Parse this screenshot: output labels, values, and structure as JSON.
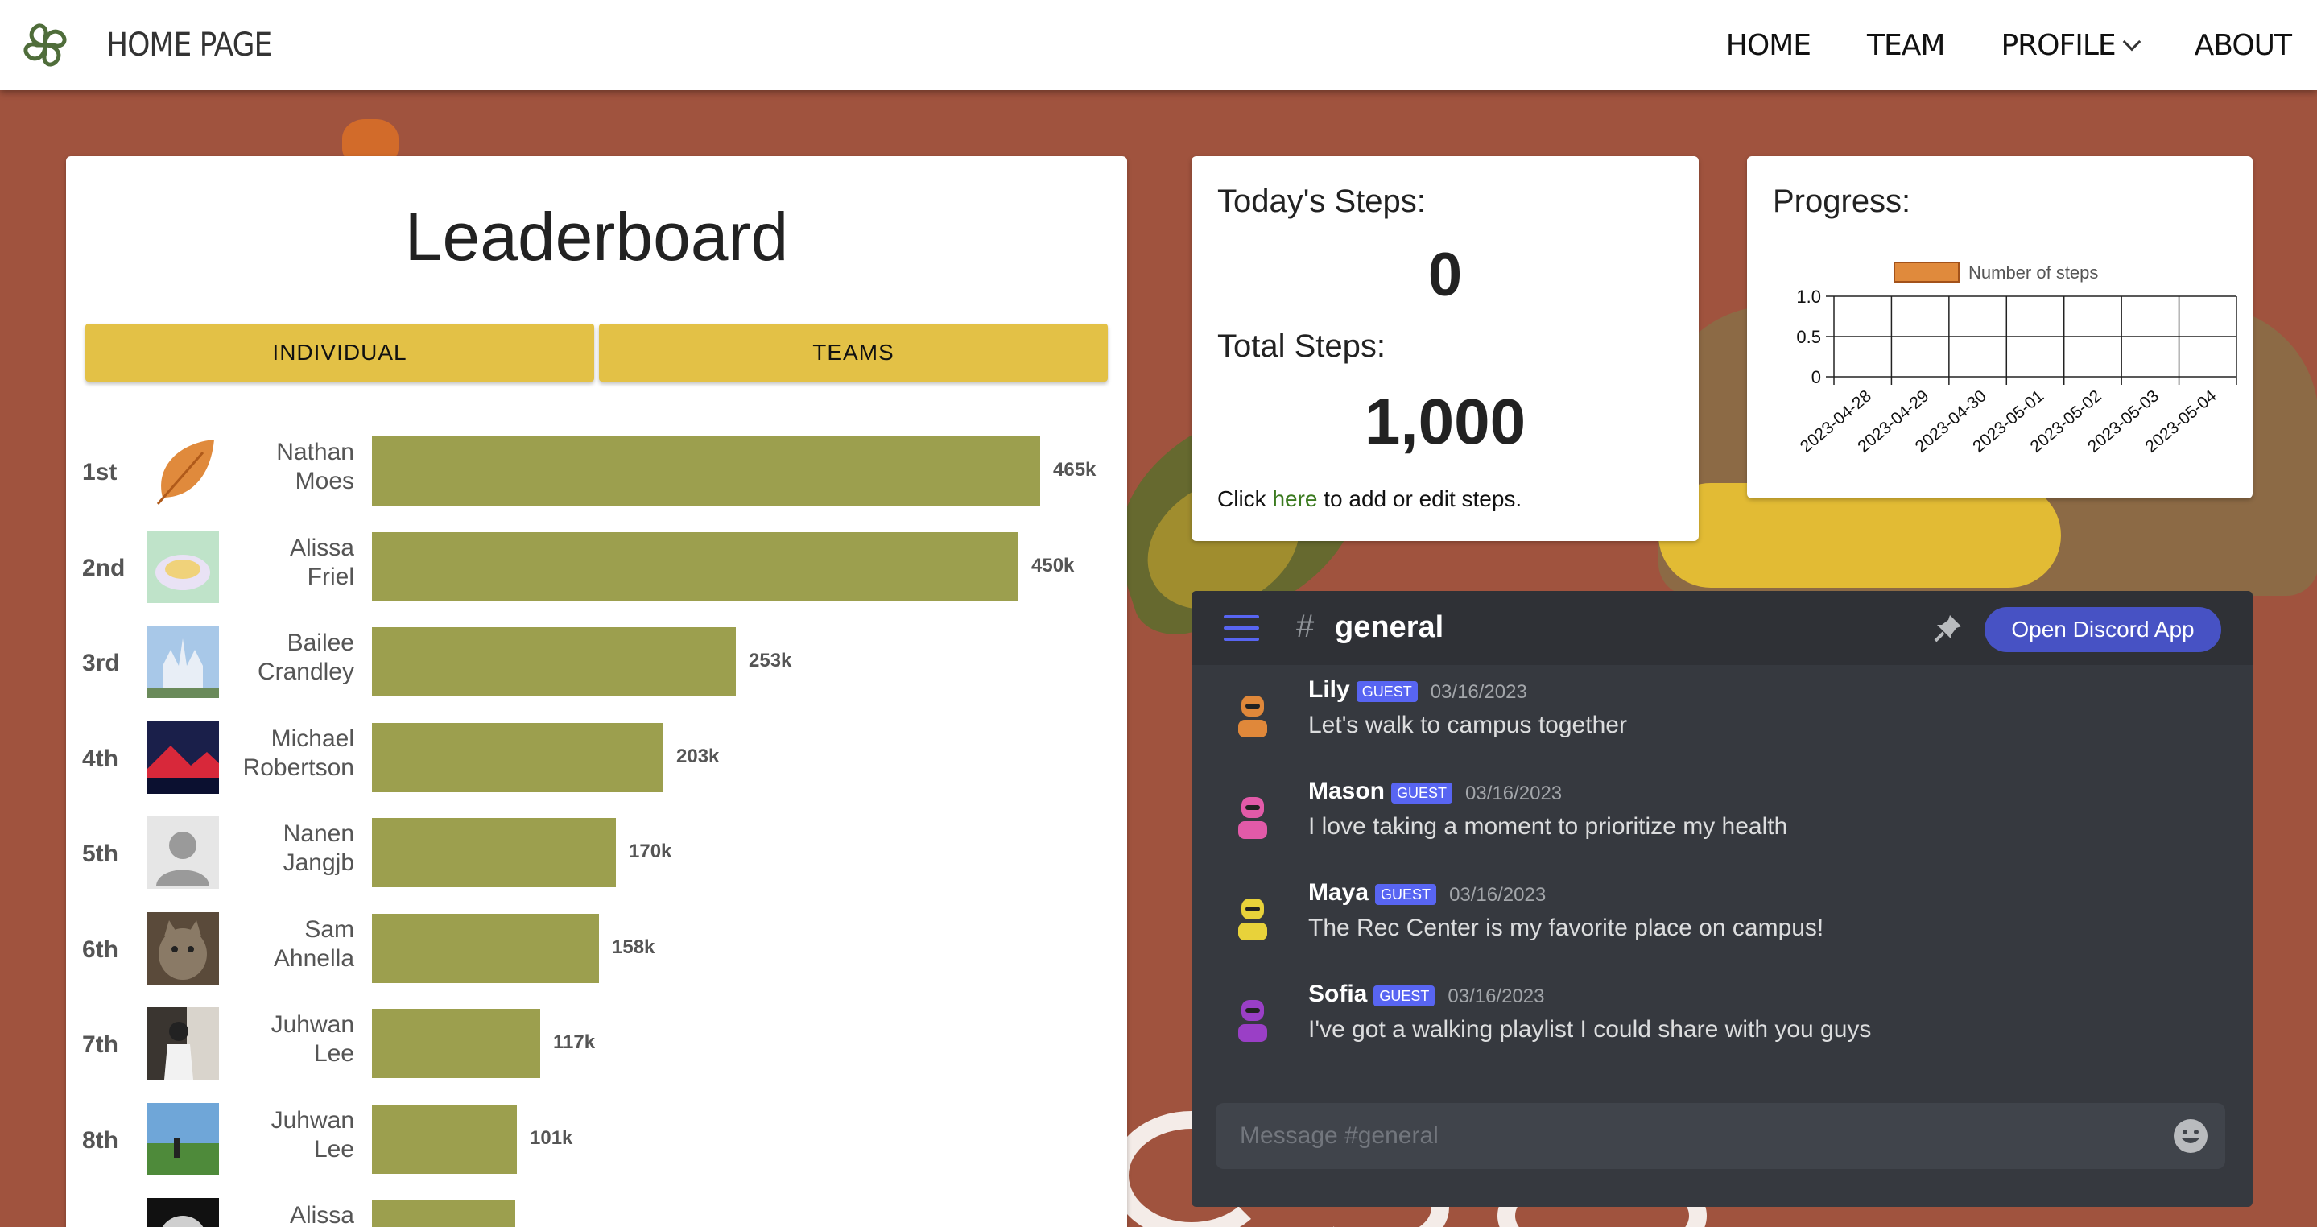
{
  "nav": {
    "brand": "HOME PAGE",
    "links": [
      "HOME",
      "TEAM",
      "PROFILE",
      "ABOUT"
    ]
  },
  "leaderboard": {
    "title": "Leaderboard",
    "tabs": [
      "INDIVIDUAL",
      "TEAMS"
    ],
    "entries": [
      {
        "rank": "1st",
        "first": "Nathan",
        "last": "Moes",
        "value": 465,
        "label": "465k",
        "avatar": "leaf-icon"
      },
      {
        "rank": "2nd",
        "first": "Alissa",
        "last": "Friel",
        "value": 450,
        "label": "450k",
        "avatar": "food-photo"
      },
      {
        "rank": "3rd",
        "first": "Bailee",
        "last": "Crandley",
        "value": 253,
        "label": "253k",
        "avatar": "castle-photo"
      },
      {
        "rank": "4th",
        "first": "Michael",
        "last": "Robertson",
        "value": 203,
        "label": "203k",
        "avatar": "landscape-photo"
      },
      {
        "rank": "5th",
        "first": "Nanen",
        "last": "Jangjb",
        "value": 170,
        "label": "170k",
        "avatar": "default-user-icon"
      },
      {
        "rank": "6th",
        "first": "Sam",
        "last": "Ahnella",
        "value": 158,
        "label": "158k",
        "avatar": "cat-photo"
      },
      {
        "rank": "7th",
        "first": "Juhwan",
        "last": "Lee",
        "value": 117,
        "label": "117k",
        "avatar": "person-photo"
      },
      {
        "rank": "8th",
        "first": "Juhwan",
        "last": "Lee",
        "value": 101,
        "label": "101k",
        "avatar": "field-photo"
      },
      {
        "rank": "",
        "first": "Alissa",
        "last": "",
        "value": 100,
        "label": "",
        "avatar": "moon-photo"
      }
    ],
    "max_value": 465
  },
  "today": {
    "steps_label": "Today's Steps:",
    "steps_value": "0",
    "total_label": "Total Steps:",
    "total_value": "1,000",
    "foot_prefix": "Click ",
    "foot_link": "here",
    "foot_suffix": " to add or edit steps."
  },
  "progress": {
    "title": "Progress:",
    "legend_color": "#e08a3c"
  },
  "chart_data": {
    "type": "bar",
    "categories": [
      "2023-04-28",
      "2023-04-29",
      "2023-04-30",
      "2023-05-01",
      "2023-05-02",
      "2023-05-03",
      "2023-05-04"
    ],
    "series": [
      {
        "name": "Number of steps",
        "values": [
          0,
          0,
          0,
          0,
          0,
          0,
          0
        ]
      }
    ],
    "yticks": [
      "1.0",
      "0.5",
      "0"
    ],
    "ylim": [
      0,
      1
    ],
    "grid": true,
    "legend": "top"
  },
  "discord": {
    "channel": "general",
    "open_button": "Open Discord App",
    "input_placeholder": "Message #general",
    "accent": "#5865f2",
    "messages": [
      {
        "name": "Lily",
        "badge": "GUEST",
        "date": "03/16/2023",
        "text": "Let's walk to campus together",
        "color": "#e0883a"
      },
      {
        "name": "Mason",
        "badge": "GUEST",
        "date": "03/16/2023",
        "text": "I love taking a moment to prioritize my health",
        "color": "#e25aa8"
      },
      {
        "name": "Maya",
        "badge": "GUEST",
        "date": "03/16/2023",
        "text": "The Rec Center is my favorite place on campus!",
        "color": "#e8d23a"
      },
      {
        "name": "Sofia",
        "badge": "GUEST",
        "date": "03/16/2023",
        "text": "I've got a walking playlist I could share with you guys",
        "color": "#9a3fc6"
      }
    ]
  }
}
